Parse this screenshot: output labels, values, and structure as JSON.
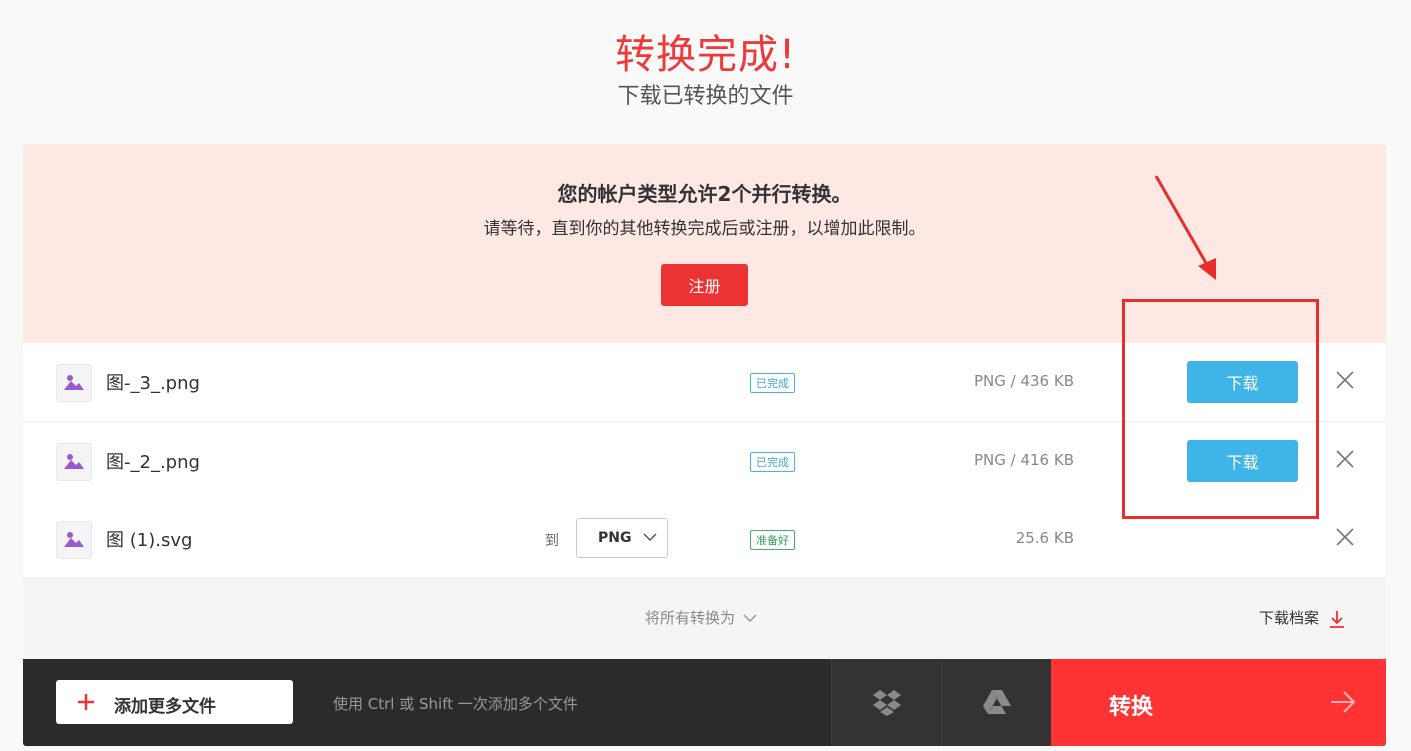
{
  "header": {
    "title": "转换完成!",
    "subtitle": "下载已转换的文件"
  },
  "notice": {
    "title": "您的帐户类型允许2个并行转换。",
    "text": "请等待，直到你的其他转换完成后或注册，以增加此限制。",
    "signup_label": "注册",
    "background": "#fde8e4"
  },
  "files": [
    {
      "name": "图-_3_.png",
      "status": "已完成",
      "size": "PNG / 436 KB",
      "action": "下载"
    },
    {
      "name": "图-_2_.png",
      "status": "已完成",
      "size": "PNG / 416 KB",
      "action": "下载"
    },
    {
      "name": "图 (1).svg",
      "to_label": "到",
      "format": "PNG",
      "status": "准备好",
      "size": "25.6 KB"
    }
  ],
  "footer": {
    "convert_all_label": "将所有转换为",
    "download_archive_label": "下载档案"
  },
  "bottom": {
    "add_more_label": "添加更多文件",
    "hint": "使用 Ctrl 或 Shift 一次添加多个文件",
    "convert_label": "转换",
    "icons": [
      "dropbox-icon",
      "google-drive-icon"
    ]
  },
  "colors": {
    "accent_red": "#ff3333",
    "download_blue": "#3fb4e8",
    "done_badge": "#3aa7d8",
    "ready_badge": "#3a9e5d"
  }
}
